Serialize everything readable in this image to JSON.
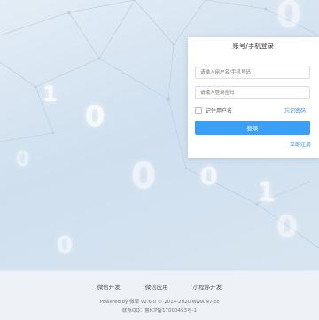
{
  "background": {
    "digits": [
      "0",
      "1",
      "0",
      "0",
      "0",
      "1",
      "0",
      "0",
      "0"
    ]
  },
  "login": {
    "title": "账号/手机登录",
    "username_placeholder": "请输入用户名/手机号码",
    "password_placeholder": "请输入登录密码",
    "remember_label": "记住用户名",
    "forgot_label": "忘记密码",
    "submit_label": "登录",
    "register_label": "立即注册"
  },
  "footer": {
    "links": [
      "微信开发",
      "微信应用",
      "小程序开发"
    ],
    "powered": "Powered by 微擎 v2.6.0 © 2014-2020 www.w7.cc",
    "icp": "联系QQ：鲁ICP备17000493号-1"
  },
  "colors": {
    "accent": "#3a9ff5",
    "link": "#3296fa",
    "footer_bg": "#eef2f6"
  }
}
